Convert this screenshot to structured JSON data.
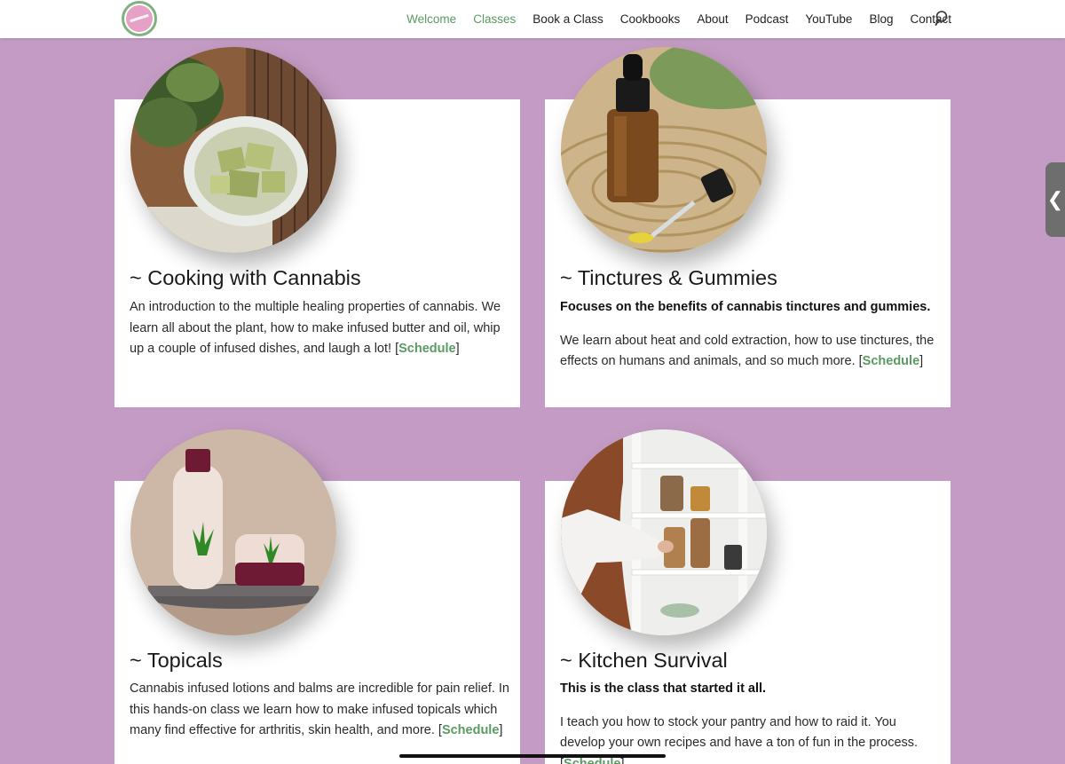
{
  "header": {
    "nav": [
      "Welcome",
      "Classes",
      "Book a Class",
      "Cookbooks",
      "About",
      "Podcast",
      "YouTube",
      "Blog",
      "Contact"
    ]
  },
  "cards": [
    {
      "title": "~ Cooking with Cannabis",
      "lead": "",
      "body": "An introduction to the multiple healing properties of cannabis. We learn all about the plant, how to make infused butter and oil, whip up a couple of infused dishes, and laugh a lot! [",
      "link": "Schedule",
      "close": "]"
    },
    {
      "title": "~ Tinctures & Gummies",
      "lead": "Focuses on the benefits of cannabis tinctures and gummies.",
      "body": "We learn about heat and cold extraction, how to use tinctures, the effects on humans and animals, and so much more. [",
      "link": "Schedule",
      "close": "]"
    },
    {
      "title": "~ Topicals",
      "lead": "",
      "body": "Cannabis infused lotions and balms are incredible for pain relief. In this hands-on class we learn how to make infused topicals which many find effective for arthritis, skin health, and more. [",
      "link": "Schedule",
      "close": "]"
    },
    {
      "title": "~ Kitchen Survival",
      "lead": "This is the class that started it all.",
      "body": "I teach you how to stock your pantry and how to raid it. You develop your own recipes and have a ton of fun in the process. [",
      "link": "Schedule",
      "close": "]"
    }
  ],
  "side_tab": {
    "glyph": "❮"
  },
  "colors": {
    "background": "#c49bc4",
    "accent_green": "#5a9b62",
    "card": "#ffffff"
  }
}
